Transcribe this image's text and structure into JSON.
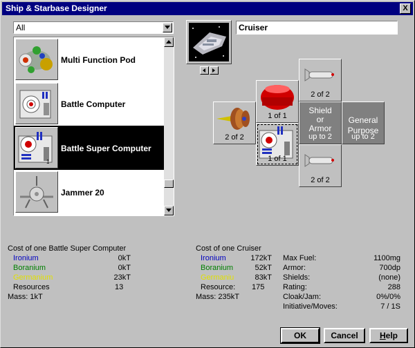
{
  "window": {
    "title": "Ship & Starbase Designer",
    "close_glyph": "X"
  },
  "filter": {
    "value": "All"
  },
  "components": [
    {
      "label": "Multi Function Pod",
      "icon": "multi-function-pod-icon"
    },
    {
      "label": "Battle Computer",
      "icon": "battle-computer-icon"
    },
    {
      "label": "Battle Super Computer",
      "icon": "battle-super-computer-icon",
      "selected": true
    },
    {
      "label": "Jammer 20",
      "icon": "jammer-icon"
    }
  ],
  "hull": {
    "name": "Cruiser"
  },
  "slots": {
    "top": {
      "count": "2 of 2",
      "icon": "torpedo-icon"
    },
    "left": {
      "count": "2 of 2",
      "icon": "engine-icon"
    },
    "fuel": {
      "count": "1 of 1",
      "icon": "fuel-tank-icon"
    },
    "shield": {
      "line1": "Shield",
      "line2": "or",
      "line3": "Armor",
      "sub": "up to 2"
    },
    "general": {
      "line1": "General",
      "line2": "Purpose",
      "sub": "up to 2"
    },
    "computer": {
      "count": "1 of 1",
      "icon": "battle-computer-icon"
    },
    "bottom": {
      "count": "2 of 2",
      "icon": "torpedo-icon"
    }
  },
  "component_cost": {
    "heading": "Cost of one Battle Super Computer",
    "ironium_label": "Ironium",
    "ironium": "0kT",
    "boranium_label": "Boranium",
    "boranium": "0kT",
    "germanium_label": "Germanium",
    "germanium": "23kT",
    "resources_label": "Resources",
    "resources": "13",
    "mass": "Mass: 1kT"
  },
  "hull_cost": {
    "heading": "Cost of one Cruiser",
    "ironium_label": "Ironium",
    "ironium": "172kT",
    "boranium_label": "Boranium",
    "boranium": "52kT",
    "germanium_label": "Germaniu",
    "germanium": "83kT",
    "resources_label": "Resource:",
    "resources": "175",
    "mass": "Mass: 235kT"
  },
  "stats": [
    {
      "label": "Max Fuel:",
      "value": "1100mg"
    },
    {
      "label": "Armor:",
      "value": "700dp"
    },
    {
      "label": "Shields:",
      "value": "(none)"
    },
    {
      "label": "Rating:",
      "value": "288"
    },
    {
      "label": "Cloak/Jam:",
      "value": "0%/0%"
    },
    {
      "label": "Initiative/Moves:",
      "value": "7 / 1S"
    }
  ],
  "buttons": {
    "ok": "OK",
    "cancel": "Cancel",
    "help_h": "H",
    "help_rest": "elp"
  },
  "colors": {
    "titlebar": "#000080",
    "ironium": "#0000c0",
    "boranium": "#008000",
    "germanium": "#e0e000"
  }
}
